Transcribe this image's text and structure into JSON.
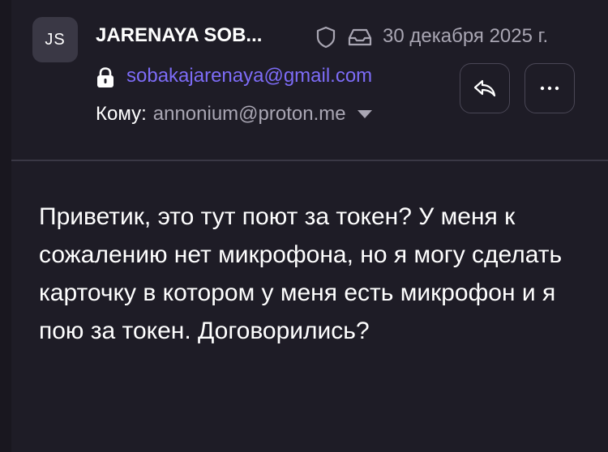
{
  "message": {
    "avatar_initials": "JS",
    "sender_name": "JARENAYA SOB...",
    "date": "30 декабря 2025 г.",
    "sender_email": "sobakajarenaya@gmail.com",
    "to_label": "Кому:",
    "to_address": "annonium@proton.me",
    "body": "Приветик, это тут поют за токен? У меня к сожалению нет микрофона, но я могу сделать карточку в котором у меня есть микрофон и я пою за токен. Договорились?"
  },
  "icons": {
    "shield": "shield-icon",
    "inbox": "inbox-icon",
    "lock": "lock-icon",
    "caret": "chevron-down-icon",
    "reply": "reply-icon",
    "more": "more-icon"
  },
  "colors": {
    "background": "#1e1c26",
    "accent_email": "#7d6cf7",
    "muted_text": "#a9a6b3",
    "border": "#4a4756"
  }
}
